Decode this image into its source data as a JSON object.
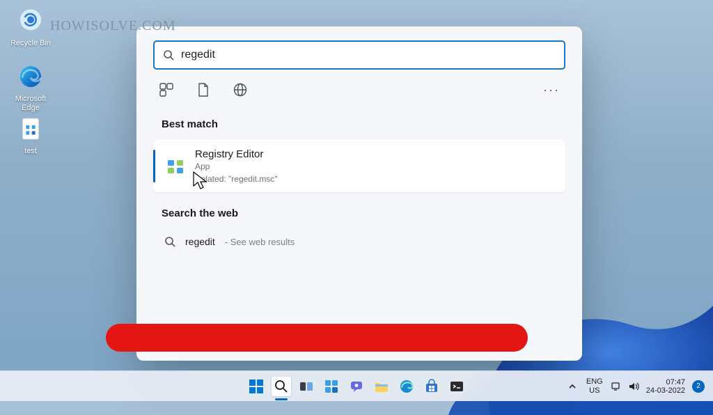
{
  "watermark": "HOWISOLVE.COM",
  "desktop": {
    "recycle_label": "Recycle Bin",
    "edge_label": "Microsoft Edge",
    "test_label": "test"
  },
  "search": {
    "query": "regedit",
    "best_match_heading": "Best match",
    "result": {
      "title": "Registry Editor",
      "subtitle": "App",
      "related": "Related: \"regedit.msc\""
    },
    "web_heading": "Search the web",
    "web_term": "regedit",
    "web_hint": "- See web results"
  },
  "systray": {
    "lang_top": "ENG",
    "lang_bot": "US",
    "time": "07:47",
    "date": "24-03-2022",
    "notif_count": "2"
  }
}
